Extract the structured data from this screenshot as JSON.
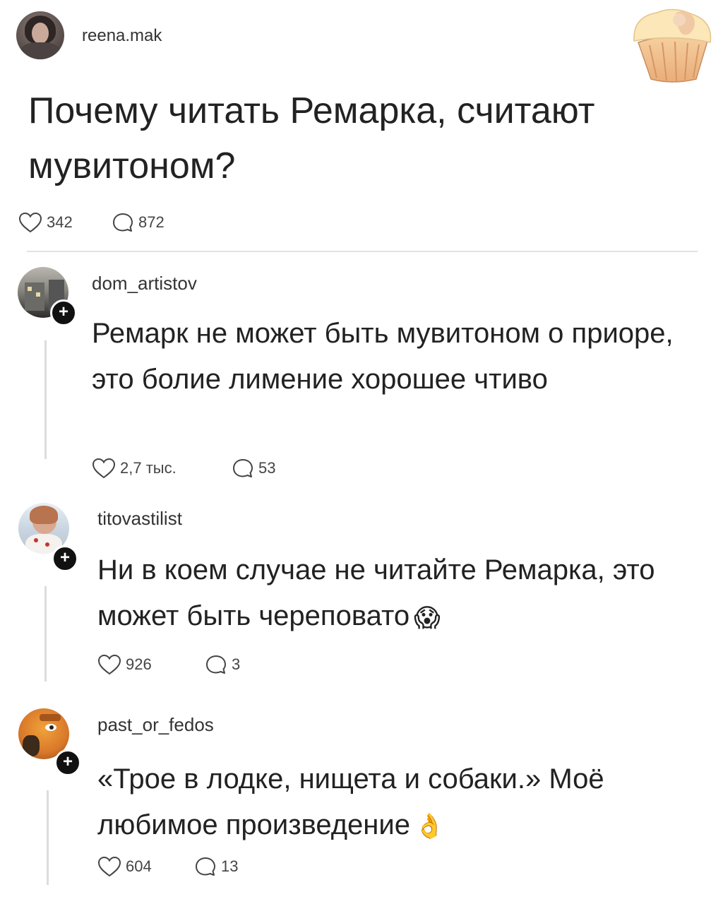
{
  "post": {
    "username": "reena.mak",
    "title": "Почему читать Ремарка, считают мувитоном?",
    "likes": "342",
    "comments": "872",
    "sticker": "muffin-sticker"
  },
  "comments": [
    {
      "username": "dom_artistov",
      "text": "Ремарк не может быть мувитоном о приоре, это болие лимение хорошее чтиво",
      "likes": "2,7 тыс.",
      "replies": "53"
    },
    {
      "username": "titovastilist",
      "text": "Ни в коем случае не читайте Ремарка, это может быть череповато",
      "emoji": "😱",
      "likes": "926",
      "replies": "3"
    },
    {
      "username": "past_or_fedos",
      "text": "«Трое в лодке, нищета и собаки.» Моё любимое произведение",
      "emoji": "👌",
      "likes": "604",
      "replies": "13"
    }
  ],
  "icons": {
    "like": "heart-icon",
    "comment": "comment-bubble-icon",
    "follow": "plus-icon"
  }
}
